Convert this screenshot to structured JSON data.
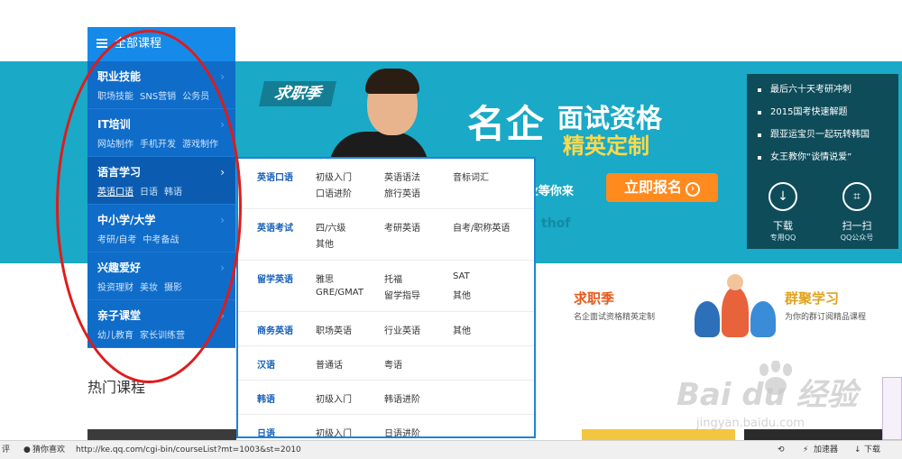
{
  "sidebar": {
    "header": "全部课程",
    "items": [
      {
        "title": "职业技能",
        "subs": [
          "职场技能",
          "SNS营销",
          "公务员"
        ]
      },
      {
        "title": "IT培训",
        "subs": [
          "网站制作",
          "手机开发",
          "游戏制作"
        ]
      },
      {
        "title": "语言学习",
        "subs": [
          "英语口语",
          "日语",
          "韩语"
        ]
      },
      {
        "title": "中小学/大学",
        "subs": [
          "考研/自考",
          "中考备战"
        ]
      },
      {
        "title": "兴趣爱好",
        "subs": [
          "投资理财",
          "美妆",
          "摄影"
        ]
      },
      {
        "title": "亲子课堂",
        "subs": [
          "幼儿教育",
          "家长训练营"
        ]
      }
    ],
    "arrow": "›"
  },
  "dropdown": {
    "rows": [
      {
        "category": "英语口语",
        "links": [
          "初级入门",
          "英语语法",
          "音标词汇",
          "口语进阶",
          "旅行英语"
        ]
      },
      {
        "category": "英语考试",
        "links": [
          "四/六级",
          "考研英语",
          "自考/职称英语",
          "其他"
        ]
      },
      {
        "category": "留学英语",
        "links": [
          "雅思",
          "托福",
          "SAT",
          "GRE/GMAT",
          "留学指导",
          "其他"
        ]
      },
      {
        "category": "商务英语",
        "links": [
          "职场英语",
          "行业英语",
          "其他"
        ]
      },
      {
        "category": "汉语",
        "links": [
          "普通话",
          "粤语"
        ]
      },
      {
        "category": "韩语",
        "links": [
          "初级入门",
          "韩语进阶"
        ]
      },
      {
        "category": "日语",
        "links": [
          "初级入门",
          "日语进阶"
        ]
      }
    ]
  },
  "banner": {
    "tag": "求职季",
    "headline_big": "名企",
    "headline_mid": "面试资格",
    "headline_sub": "精英定制",
    "slogan": "+企业等你来",
    "cta": "立即报名",
    "cta_icon": "›",
    "partners": "thof"
  },
  "right_panel": {
    "items": [
      "最后六十天考研冲刺",
      "2015国考快速解题",
      "跟亚运宝贝一起玩转韩国",
      "女王教你“谈情说爱”"
    ],
    "download_label": "下载",
    "download_sub": "专用QQ",
    "scan_label": "扫一扫",
    "scan_sub": "QQ公众号",
    "download_icon": "↓",
    "scan_icon": "⌗"
  },
  "cards": {
    "job_title": "求职季",
    "job_sub": "名企面试资格精英定制",
    "group_title": "群聚学习",
    "group_sub": "为你的群订阅精品课程"
  },
  "section": {
    "hot": "热门课程"
  },
  "watermark": {
    "main": "Bai du 经验",
    "url": "jingyan.baidu.com"
  },
  "status_bar": {
    "left1": "评",
    "left2": "猜你喜欢",
    "url": "http://ke.qq.com/cgi-bin/courseList?mt=1003&st=2010",
    "accel": "加速器",
    "download": "下载"
  },
  "colors": {
    "banner": "#1aa9c6",
    "sidebar": "#0f6cc9",
    "accent": "#ff8a1e",
    "annotation": "#e01b1b"
  }
}
